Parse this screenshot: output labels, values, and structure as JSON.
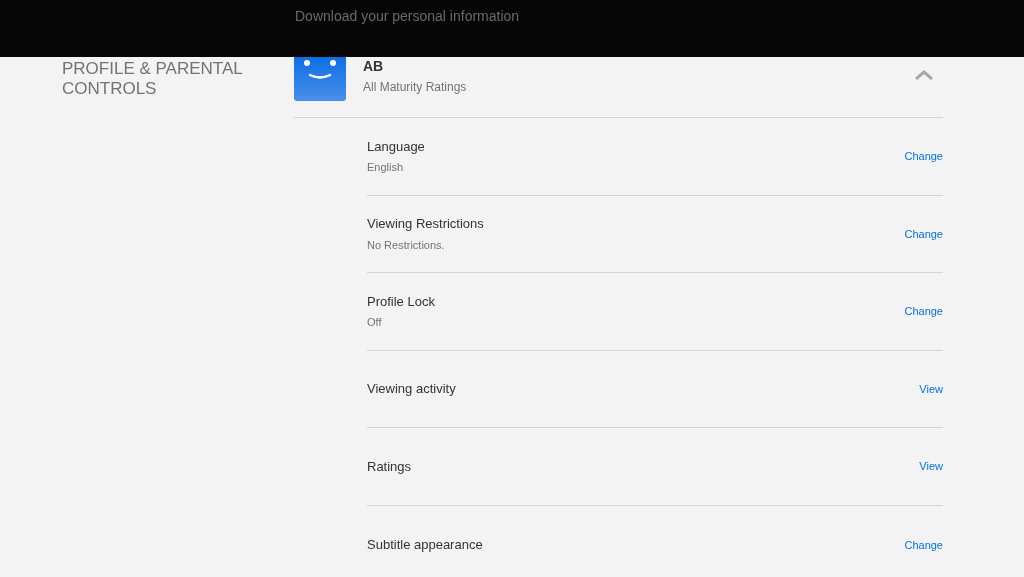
{
  "top_bar": {
    "text": "Download your personal information"
  },
  "section": {
    "title": "PROFILE & PARENTAL CONTROLS"
  },
  "profile": {
    "name": "AB",
    "subtitle": "All Maturity Ratings",
    "expanded": true
  },
  "settings": [
    {
      "label": "Language",
      "value": "English",
      "action": "Change"
    },
    {
      "label": "Viewing Restrictions",
      "value": "No Restrictions.",
      "action": "Change"
    },
    {
      "label": "Profile Lock",
      "value": "Off",
      "action": "Change"
    },
    {
      "label": "Viewing activity",
      "action": "View"
    },
    {
      "label": "Ratings",
      "action": "View"
    },
    {
      "label": "Subtitle appearance",
      "action": "Change"
    }
  ]
}
